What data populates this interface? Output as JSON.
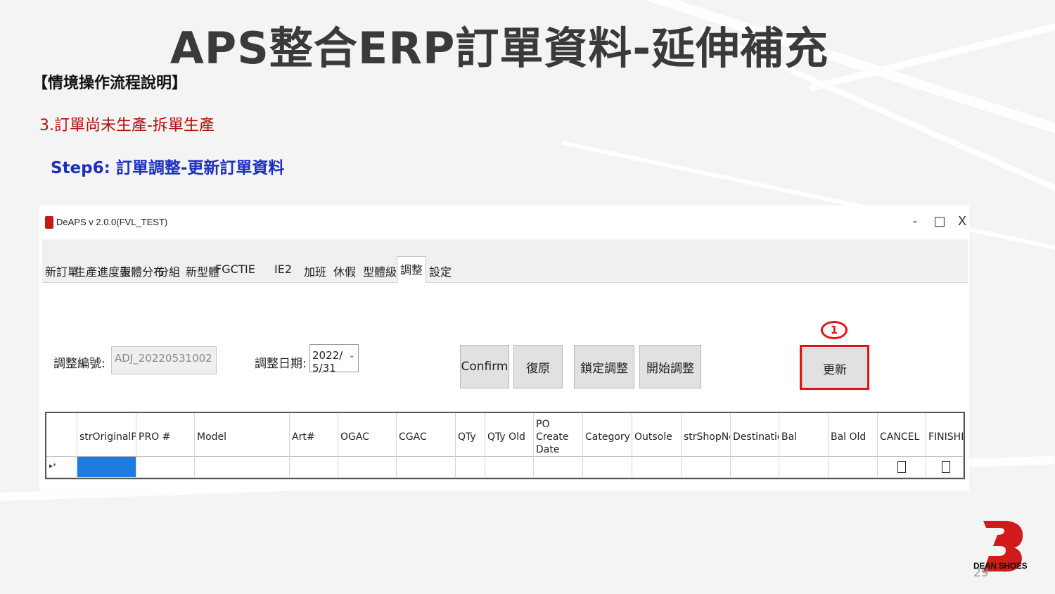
{
  "slide": {
    "title": "APS整合ERP訂單資料-延伸補充",
    "subheading": "【情境操作流程說明】",
    "scenario": "3.訂單尚未生產-拆單生產",
    "step": "Step6: 訂單調整-更新訂單資料",
    "page_number": "29",
    "brand_name": "DEAN SHOES",
    "marker_number": "1"
  },
  "app": {
    "window_title": "DeAPS v 2.0.0(FVL_TEST)",
    "window_controls": {
      "minimize": "-",
      "maximize": "□",
      "close": "X"
    },
    "tabs": [
      {
        "label": "新訂單"
      },
      {
        "label": "生產進度表"
      },
      {
        "label": "型體分布"
      },
      {
        "label": "分組"
      },
      {
        "label": "新型體"
      },
      {
        "label": "FGCT"
      },
      {
        "label": "IE"
      },
      {
        "label": "IE2"
      },
      {
        "label": "加班"
      },
      {
        "label": "休假"
      },
      {
        "label": "型體級別"
      },
      {
        "label": "調整"
      },
      {
        "label": "設定"
      }
    ],
    "active_tab": "調整",
    "form": {
      "adj_no_label": "調整編號:",
      "adj_no_value": "ADJ_20220531002",
      "adj_date_label": "調整日期:",
      "adj_date_value": "2022/ 5/31"
    },
    "buttons": {
      "confirm": "Confirm",
      "restore": "復原",
      "lock_adjust": "鎖定調整",
      "start_adjust": "開始調整",
      "update": "更新"
    },
    "grid": {
      "columns": [
        "strOriginalProNo",
        "PRO #",
        "Model",
        "Art#",
        "OGAC",
        "CGAC",
        "QTy",
        "QTy Old",
        "PO Create Date",
        "Category",
        "Outsole",
        "strShopNo",
        "Destination",
        "Bal",
        "Bal Old",
        "CANCEL",
        "FINISHED"
      ],
      "row_pointer": "▸*"
    }
  },
  "colors": {
    "highlight": "#e51212",
    "scenario_red": "#b01010",
    "step_blue": "#1b2ec2",
    "selected_cell": "#1e7be0"
  }
}
